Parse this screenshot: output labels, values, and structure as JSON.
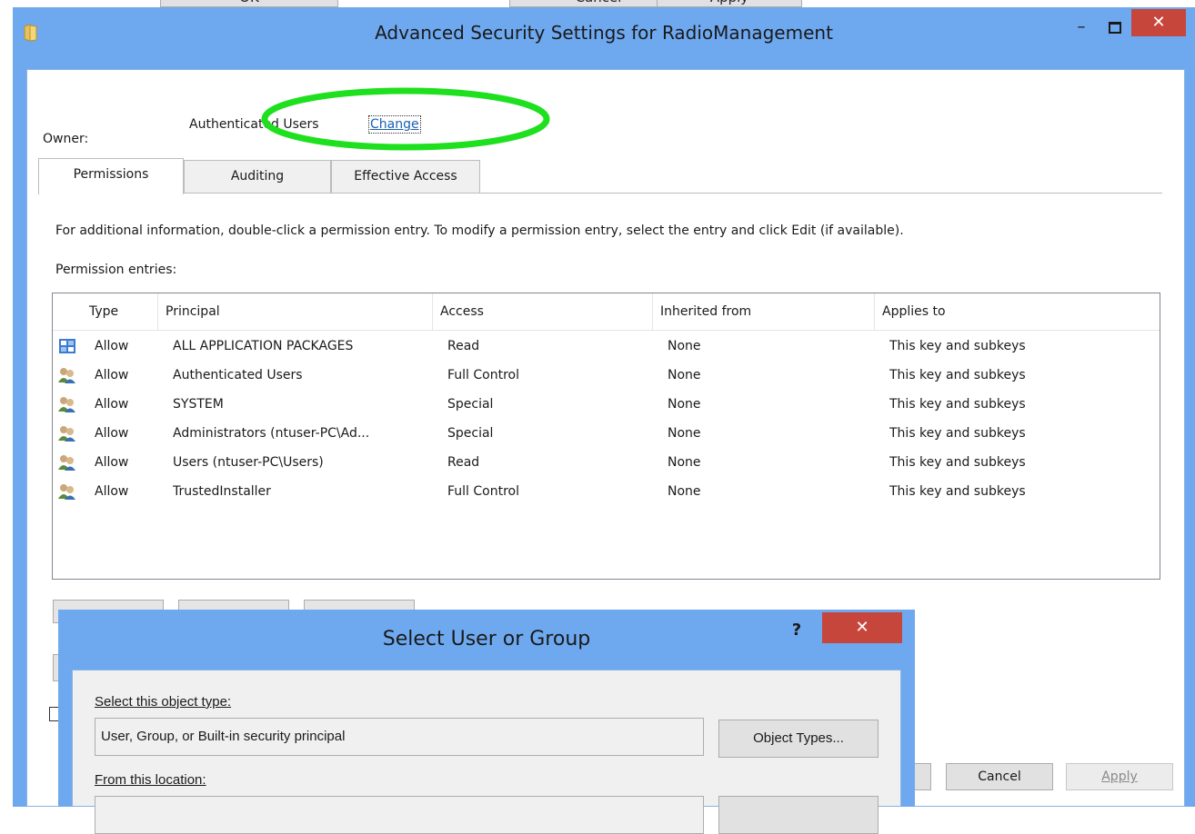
{
  "background": {
    "buttons": [
      "OK",
      "Cancel",
      "Apply"
    ]
  },
  "main_dialog": {
    "title": "Advanced Security Settings for RadioManagement",
    "minimize_glyph": "–",
    "close_glyph": "✕",
    "owner_label": "Owner:",
    "owner_value": "Authenticated Users",
    "owner_change": "Change",
    "tabs": [
      {
        "label": "Permissions",
        "active": true
      },
      {
        "label": "Auditing",
        "active": false
      },
      {
        "label": "Effective Access",
        "active": false
      }
    ],
    "info_text": "For additional information, double-click a permission entry. To modify a permission entry, select the entry and click Edit (if available).",
    "entries_label": "Permission entries:",
    "columns": [
      "Type",
      "Principal",
      "Access",
      "Inherited from",
      "Applies to"
    ],
    "rows": [
      {
        "icon": "packages-icon",
        "type": "Allow",
        "principal": "ALL APPLICATION PACKAGES",
        "access": "Read",
        "inherited": "None",
        "applies": "This key and subkeys"
      },
      {
        "icon": "users-icon",
        "type": "Allow",
        "principal": "Authenticated Users",
        "access": "Full Control",
        "inherited": "None",
        "applies": "This key and subkeys"
      },
      {
        "icon": "users-icon",
        "type": "Allow",
        "principal": "SYSTEM",
        "access": "Special",
        "inherited": "None",
        "applies": "This key and subkeys"
      },
      {
        "icon": "users-icon",
        "type": "Allow",
        "principal": "Administrators (ntuser-PC\\Ad...",
        "access": "Special",
        "inherited": "None",
        "applies": "This key and subkeys"
      },
      {
        "icon": "users-icon",
        "type": "Allow",
        "principal": "Users (ntuser-PC\\Users)",
        "access": "Read",
        "inherited": "None",
        "applies": "This key and subkeys"
      },
      {
        "icon": "users-icon",
        "type": "Allow",
        "principal": "TrustedInstaller",
        "access": "Full Control",
        "inherited": "None",
        "applies": "This key and subkeys"
      }
    ],
    "cancel_label": "Cancel",
    "apply_label": "Apply"
  },
  "select_dialog": {
    "title": "Select User or Group",
    "help_glyph": "?",
    "close_glyph": "✕",
    "object_type_label": "Select this object type:",
    "object_type_value": "User, Group, or Built-in security principal",
    "object_types_button": "Object Types...",
    "location_label": "From this location:"
  },
  "colors": {
    "title_bar": "#6ea9f0",
    "close_button": "#c7463c",
    "highlight_ellipse": "#1ee01e",
    "link": "#1a5fb4"
  }
}
